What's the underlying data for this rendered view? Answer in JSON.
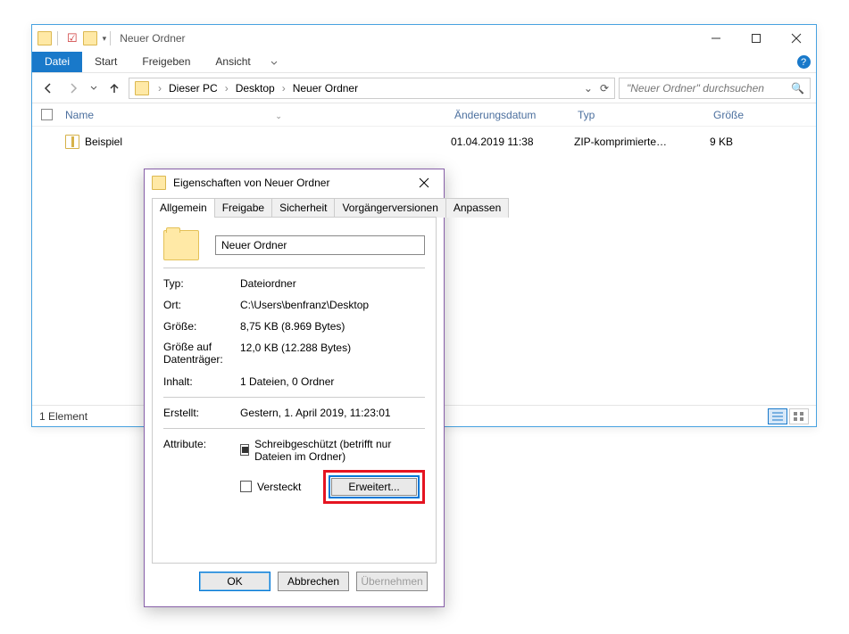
{
  "explorer": {
    "title": "Neuer Ordner",
    "ribbon": {
      "file": "Datei",
      "tabs": [
        "Start",
        "Freigeben",
        "Ansicht"
      ]
    },
    "breadcrumb": [
      "Dieser PC",
      "Desktop",
      "Neuer Ordner"
    ],
    "search_placeholder": "\"Neuer Ordner\" durchsuchen",
    "columns": {
      "name": "Name",
      "modified": "Änderungsdatum",
      "type": "Typ",
      "size": "Größe"
    },
    "files": [
      {
        "name": "Beispiel",
        "modified": "01.04.2019 11:38",
        "type": "ZIP-komprimierte…",
        "size": "9 KB"
      }
    ],
    "status": "1 Element"
  },
  "props": {
    "title": "Eigenschaften von Neuer Ordner",
    "tabs": [
      "Allgemein",
      "Freigabe",
      "Sicherheit",
      "Vorgängerversionen",
      "Anpassen"
    ],
    "name_value": "Neuer Ordner",
    "labels": {
      "type": "Typ:",
      "location": "Ort:",
      "size": "Größe:",
      "size_on_disk1": "Größe auf",
      "size_on_disk2": "Datenträger:",
      "contents": "Inhalt:",
      "created": "Erstellt:",
      "attributes": "Attribute:",
      "readonly": "Schreibgeschützt (betrifft nur Dateien im Ordner)",
      "hidden": "Versteckt",
      "advanced": "Erweitert..."
    },
    "values": {
      "type": "Dateiordner",
      "location": "C:\\Users\\benfranz\\Desktop",
      "size": "8,75 KB (8.969 Bytes)",
      "size_on_disk": "12,0 KB (12.288 Bytes)",
      "contents": "1 Dateien, 0 Ordner",
      "created": "Gestern, ‎1. ‎April ‎2019, ‏‎11:23:01"
    },
    "buttons": {
      "ok": "OK",
      "cancel": "Abbrechen",
      "apply": "Übernehmen"
    }
  }
}
